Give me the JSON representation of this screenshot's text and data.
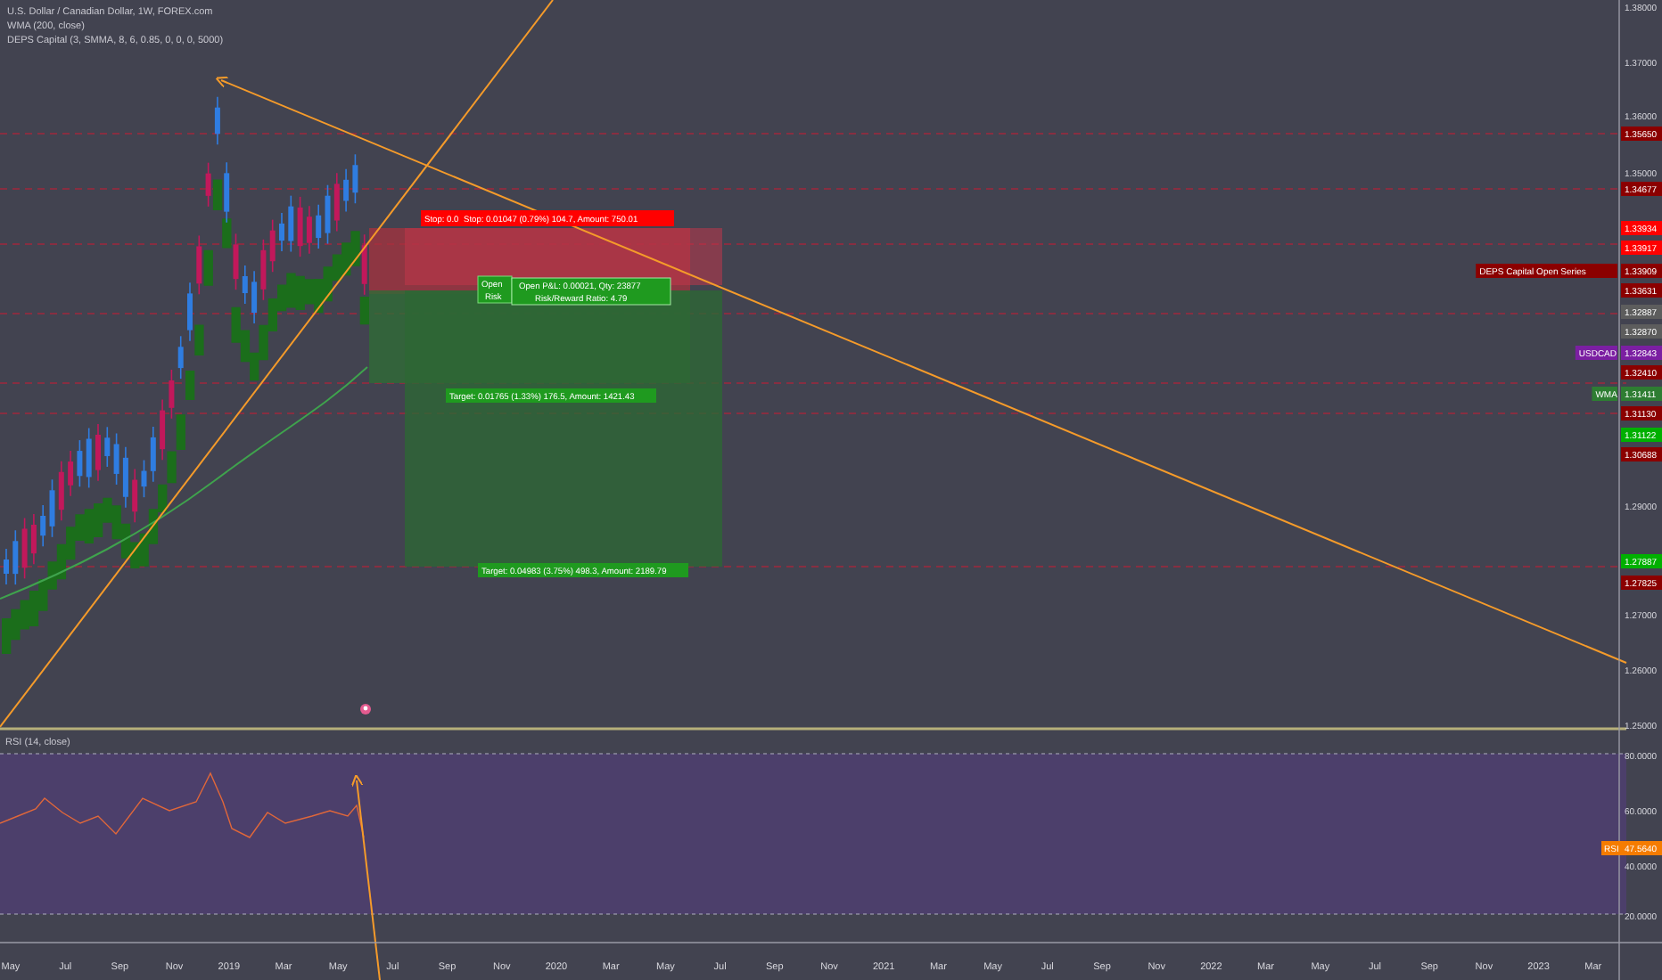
{
  "legend": [
    "U.S. Dollar / Canadian Dollar, 1W, FOREX.com",
    "WMA (200, close)",
    "DEPS Capital (3, SMMA, 8, 6, 0.85, 0, 0, 0, 5000)"
  ],
  "price_axis": {
    "ticks": [
      "1.38000",
      "1.37000",
      "1.36000",
      "1.35000",
      "1.29000",
      "1.27000",
      "1.26000",
      "1.25000"
    ],
    "tags": [
      {
        "value": "1.35650",
        "color": "#8b0000"
      },
      {
        "value": "1.34677",
        "color": "#8b0000"
      },
      {
        "value": "1.33934",
        "color": "#ff0000"
      },
      {
        "value": "1.33917",
        "color": "#ff0000"
      },
      {
        "value": "1.33909",
        "name": "DEPS Capital Open Series",
        "color": "#8b0000"
      },
      {
        "value": "1.33631",
        "color": "#8b0000"
      },
      {
        "value": "1.32887",
        "color": "#5d5d5d"
      },
      {
        "value": "1.32870",
        "color": "#5d5d5d"
      },
      {
        "value": "1.32843",
        "name": "USDCAD",
        "color": "#7b1fa2"
      },
      {
        "value": "1.32410",
        "color": "#8b0000"
      },
      {
        "value": "1.31411",
        "name": "WMA",
        "color": "#2e7d32"
      },
      {
        "value": "1.31130",
        "color": "#8b0000"
      },
      {
        "value": "1.31122",
        "color": "#00b000"
      },
      {
        "value": "1.30688",
        "color": "#8b0000"
      },
      {
        "value": "1.27887",
        "color": "#00b000"
      },
      {
        "value": "1.27825",
        "color": "#8b0000"
      }
    ]
  },
  "position": {
    "stop_label": [
      "Stop: 0.0",
      "Stop: 0.01047 (0.79%) 104.7, Amount: 750.01"
    ],
    "back_card": [
      "Open",
      "Risk"
    ],
    "pnl_card": [
      "Open P&L: 0.00021, Qty: 23877",
      "Risk/Reward Ratio: 4.79"
    ],
    "targets": [
      "Target: 0.01765 (1.33%) 176.5, Amount: 1421.43",
      "Target: 0.04983 (3.75%) 498.3, Amount: 2189.79"
    ]
  },
  "rsi": {
    "label": "RSI (14, close)",
    "ticks": [
      "80.0000",
      "60.0000",
      "40.0000",
      "20.0000"
    ],
    "tag": {
      "name": "RSI",
      "value": "47.5640",
      "color": "#f57c00"
    }
  },
  "time_axis": [
    "May",
    "Jul",
    "Sep",
    "Nov",
    "2019",
    "Mar",
    "May",
    "Jul",
    "Sep",
    "Nov",
    "2020",
    "Mar",
    "May",
    "Jul",
    "Sep",
    "Nov",
    "2021",
    "Mar",
    "May",
    "Jul",
    "Sep",
    "Nov",
    "2022",
    "Mar",
    "May",
    "Jul",
    "Sep",
    "Nov",
    "2023",
    "Mar"
  ]
}
